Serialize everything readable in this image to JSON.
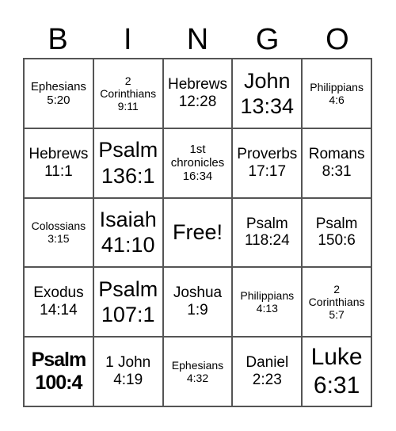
{
  "header": [
    "B",
    "I",
    "N",
    "G",
    "O"
  ],
  "cells": [
    {
      "text": "Ephesians 5:20",
      "size": "s-s"
    },
    {
      "text": "2 Corinthians 9:11",
      "size": "s-xs"
    },
    {
      "text": "Hebrews 12:28",
      "size": "s-m"
    },
    {
      "text": "John 13:34",
      "size": "s-l"
    },
    {
      "text": "Philippians 4:6",
      "size": "s-xs"
    },
    {
      "text": "Hebrews 11:1",
      "size": "s-m"
    },
    {
      "text": "Psalm 136:1",
      "size": "s-l"
    },
    {
      "text": "1st chronicles 16:34",
      "size": "s-s"
    },
    {
      "text": "Proverbs 17:17",
      "size": "s-m"
    },
    {
      "text": "Romans 8:31",
      "size": "s-m"
    },
    {
      "text": "Colossians 3:15",
      "size": "s-xs"
    },
    {
      "text": "Isaiah 41:10",
      "size": "s-l"
    },
    {
      "text": "Free!",
      "size": "s-l"
    },
    {
      "text": "Psalm 118:24",
      "size": "s-m"
    },
    {
      "text": "Psalm 150:6",
      "size": "s-m"
    },
    {
      "text": "Exodus 14:14",
      "size": "s-m"
    },
    {
      "text": "Psalm 107:1",
      "size": "s-l"
    },
    {
      "text": "Joshua 1:9",
      "size": "s-m"
    },
    {
      "text": "Philippians 4:13",
      "size": "s-xs"
    },
    {
      "text": "2 Corinthians 5:7",
      "size": "s-xs"
    },
    {
      "text": "Psalm 100:4",
      "size": "bold"
    },
    {
      "text": "1 John 4:19",
      "size": "s-m"
    },
    {
      "text": "Ephesians 4:32",
      "size": "s-xs"
    },
    {
      "text": "Daniel 2:23",
      "size": "s-m"
    },
    {
      "text": "Luke 6:31",
      "size": "s-xl"
    }
  ]
}
